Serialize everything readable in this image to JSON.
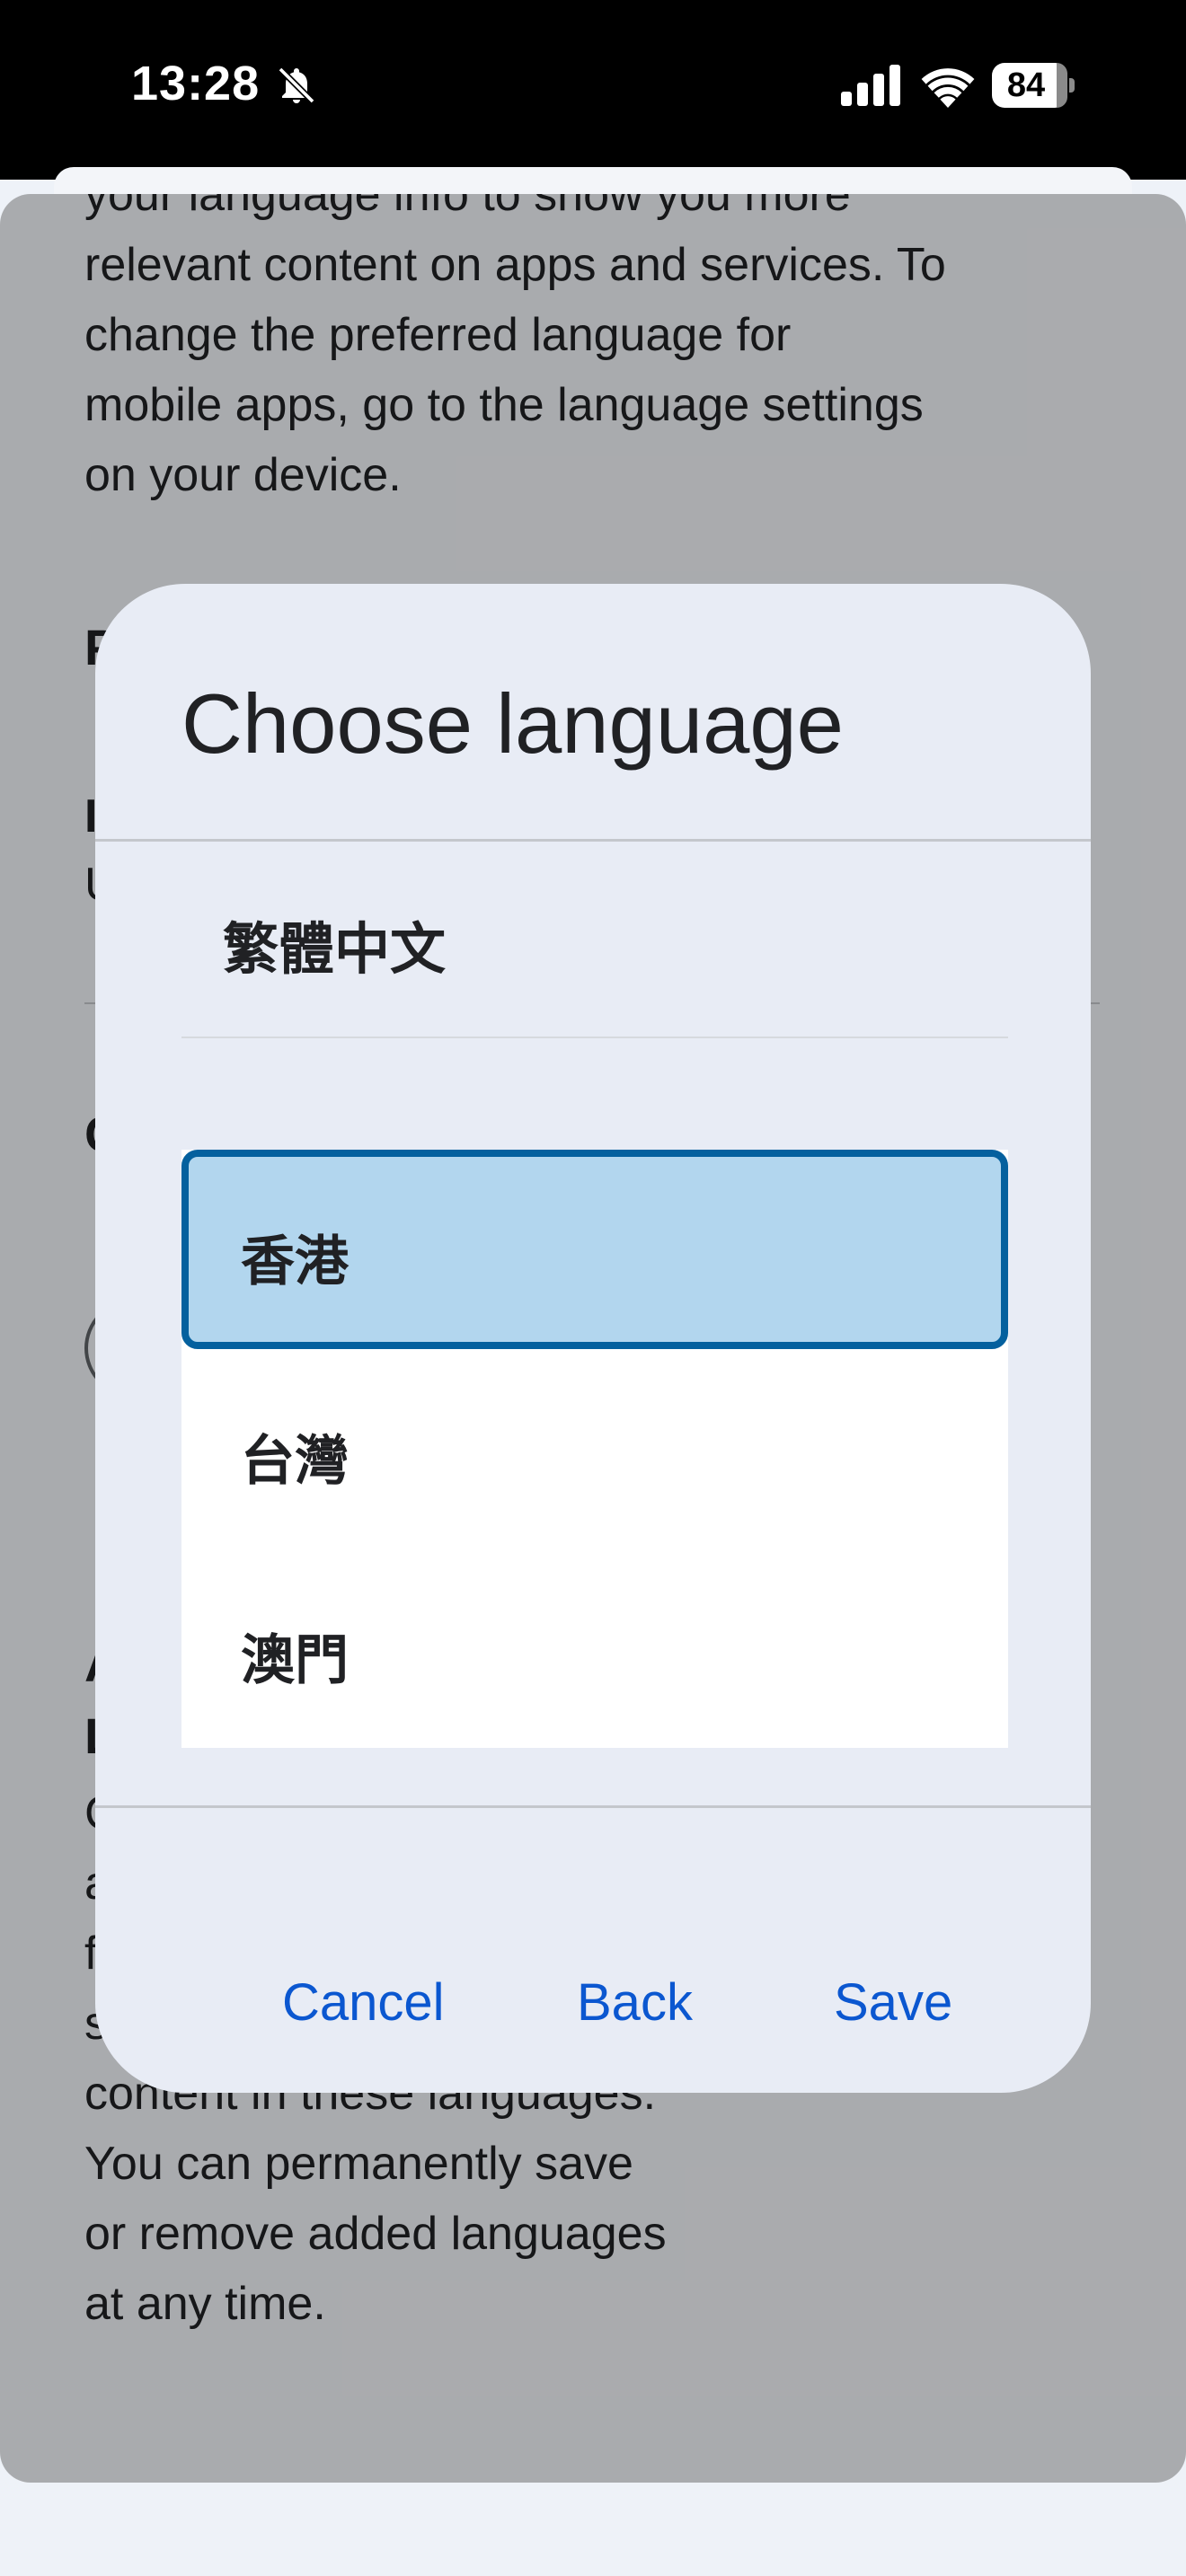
{
  "status_bar": {
    "time": "13:28",
    "battery": "84",
    "icons": [
      "bell-off-icon",
      "cellular-signal-icon",
      "wifi-icon",
      "battery-icon"
    ]
  },
  "background": {
    "paragraph_lines": [
      "your language info to show you more",
      "relevant content on apps and services. To",
      "change the preferred language for",
      "mobile apps, go to the language settings",
      "on your device."
    ],
    "partial_heading_1": "P",
    "partial_heading_2": "I",
    "partial_heading_2b": "U",
    "partial_heading_3": "C",
    "partial_heading_4a": "A",
    "partial_heading_4b": "L",
    "bottom_paragraph_partial": [
      "C",
      "a",
      "f",
      "s"
    ],
    "bottom_paragraph_lines": [
      "content in these languages.",
      "You can permanently save",
      "or remove added languages",
      "at any time."
    ]
  },
  "dialog": {
    "title": "Choose language",
    "selected_language": "繁體中文",
    "regions": [
      "香港",
      "台灣",
      "澳門"
    ],
    "selected_region_index": 0,
    "buttons": {
      "cancel": "Cancel",
      "back": "Back",
      "save": "Save"
    }
  },
  "colors": {
    "accent": "#0b57d0",
    "selection_fill": "#b2d6ee",
    "selection_border": "#04609e",
    "dialog_bg": "#e8ecf5"
  }
}
